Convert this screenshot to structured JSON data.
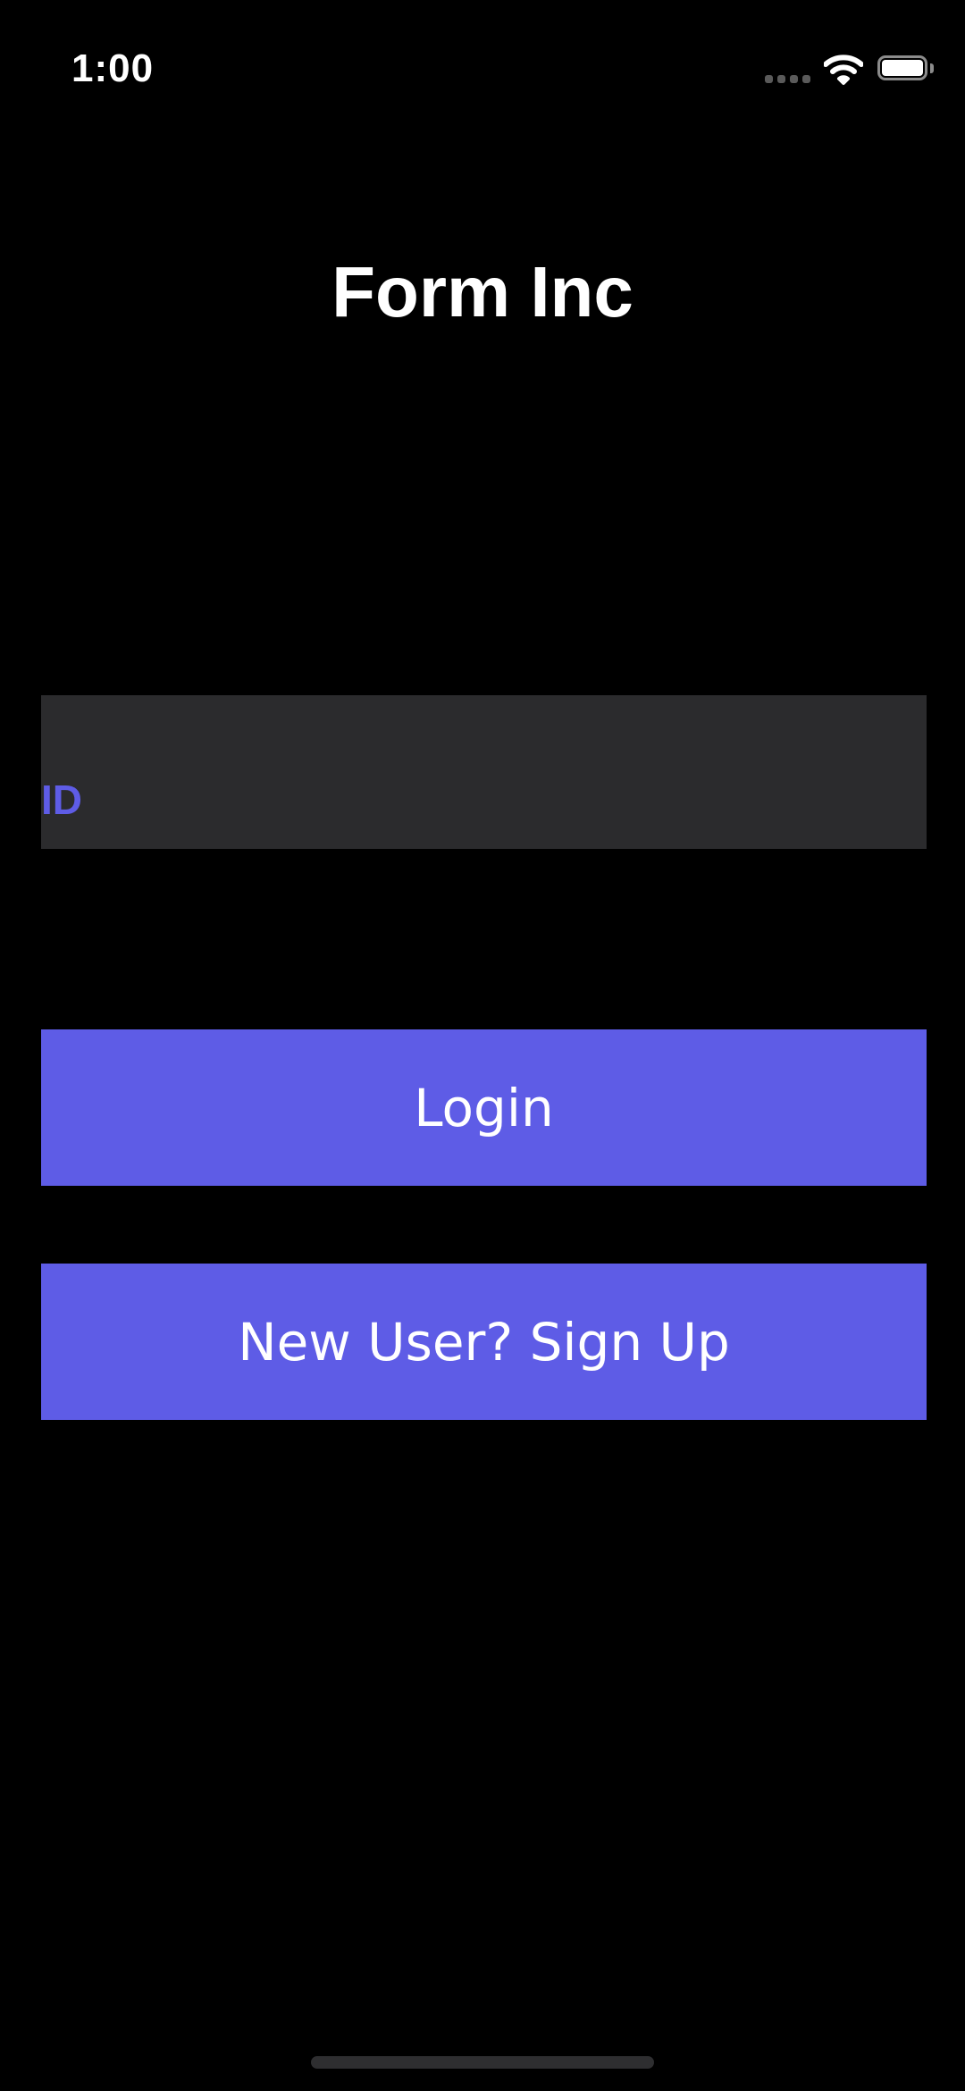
{
  "status_bar": {
    "time": "1:00",
    "icons": [
      "cellular-signal-icon",
      "wifi-icon",
      "battery-icon"
    ]
  },
  "header": {
    "title": "Form Inc"
  },
  "form": {
    "id_label": "ID",
    "id_value": "",
    "login_label": "Login",
    "signup_label": "New User? Sign Up"
  },
  "colors": {
    "background": "#000000",
    "accent": "#5e5ce6",
    "field_background": "#2b2b2d",
    "text": "#ffffff"
  }
}
